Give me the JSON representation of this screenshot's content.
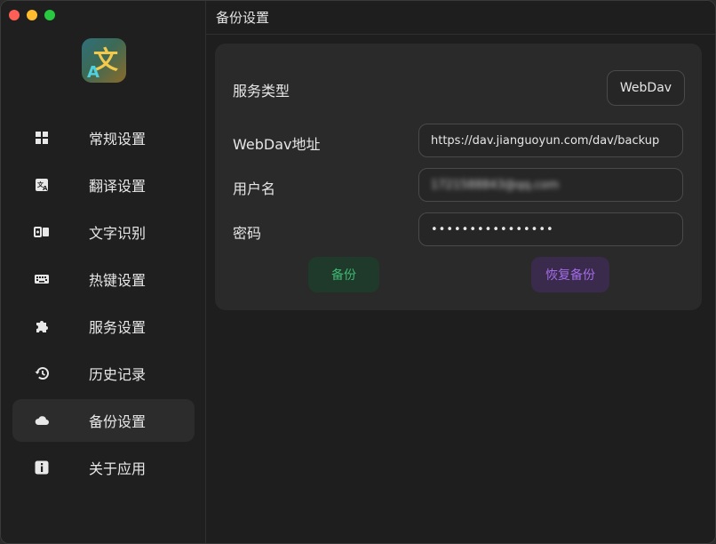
{
  "header": {
    "title": "备份设置"
  },
  "sidebar": {
    "items": [
      {
        "label": "常规设置",
        "icon": "grid-icon"
      },
      {
        "label": "翻译设置",
        "icon": "translate-icon"
      },
      {
        "label": "文字识别",
        "icon": "ocr-icon"
      },
      {
        "label": "热键设置",
        "icon": "keyboard-icon"
      },
      {
        "label": "服务设置",
        "icon": "puzzle-icon"
      },
      {
        "label": "历史记录",
        "icon": "history-icon"
      },
      {
        "label": "备份设置",
        "icon": "cloud-icon",
        "active": true
      },
      {
        "label": "关于应用",
        "icon": "info-icon"
      }
    ]
  },
  "backup": {
    "service_type_label": "服务类型",
    "service_type_value": "WebDav",
    "url_label": "WebDav地址",
    "url_value": "https://dav.jianguoyun.com/dav/backup",
    "username_label": "用户名",
    "username_value": "1721588843@qq.com",
    "password_label": "密码",
    "password_value": "••••••••••••••••",
    "backup_button": "备份",
    "restore_button": "恢复备份"
  },
  "colors": {
    "backup_text": "#3fb873",
    "restore_text": "#a36be6",
    "active_nav_bg": "#2c2c2c"
  }
}
